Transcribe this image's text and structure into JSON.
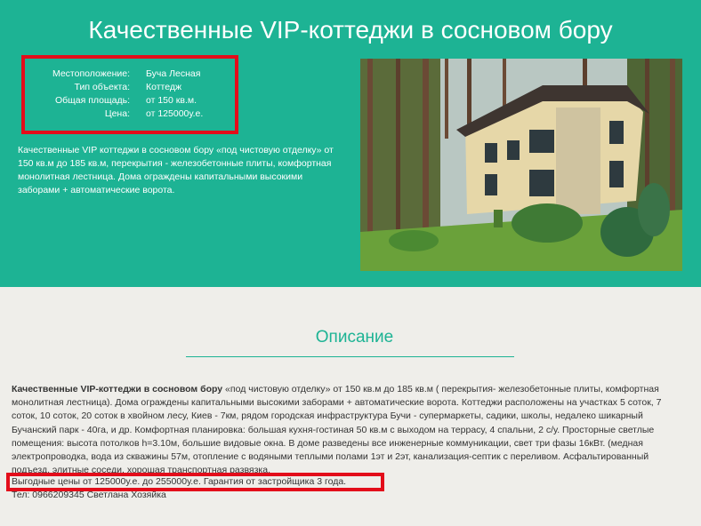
{
  "hero": {
    "title": "Качественные VIP-коттеджи в сосновом бору",
    "properties": [
      {
        "label": "Местоположение:",
        "value": "Буча Лесная"
      },
      {
        "label": "Тип объекта:",
        "value": "Коттедж"
      },
      {
        "label": "Общая площадь:",
        "value": "от 150 кв.м."
      },
      {
        "label": "Цена:",
        "value": "от 125000у.е."
      }
    ],
    "description": "Качественные VIP коттеджи в сосновом бору «под чистовую отделку» от 150 кв.м до 185 кв.м, перекрытия - железобетонные плиты, комфортная монолитная лестница. Дома ограждены капитальными высокими заборами + автоматические ворота.",
    "photo_icon": "house-photo"
  },
  "description_section": {
    "title": "Описание",
    "lead_bold": "Качественные VIP-коттеджи в сосновом бору",
    "text": " «под чистовую отделку» от 150 кв.м до 185 кв.м ( перекрытия- железобетонные плиты, комфортная монолитная лестница). Дома ограждены  капитальными высокими заборами + автоматические ворота. Коттеджи расположены на участках 5 соток, 7 соток, 10 соток, 20 соток в хвойном лесу, Киев - 7км, рядом городская инфраструктура Бучи - супермаркеты, садики, школы, недалеко шикарный Бучанский парк - 40га, и др. Комфортная планировка: большая кухня-гостиная 50 кв.м с выходом на террасу, 4 спальни, 2 с/у. Просторные светлые помещения: высота потолков h=3.10м, большие видовые окна. В доме разведены все инженерные коммуникации, свет три фазы 16кВт. (медная электропроводка, вода из скважины 57м, отопление с водяными теплыми полами 1эт и 2эт, канализация-септик с переливом. Асфальтированный подъезд, элитные соседи, хорошая транспортная развязка.",
    "promo": "Выгодные цены от 125000у.е. до 255000у.е. Гарантия от застройщика 3 года.",
    "tel": "Тел: 0966209345 Светлана Хозяйка"
  },
  "colors": {
    "accent": "#1db394",
    "highlight": "#e30d1a",
    "background": "#efeeea"
  }
}
